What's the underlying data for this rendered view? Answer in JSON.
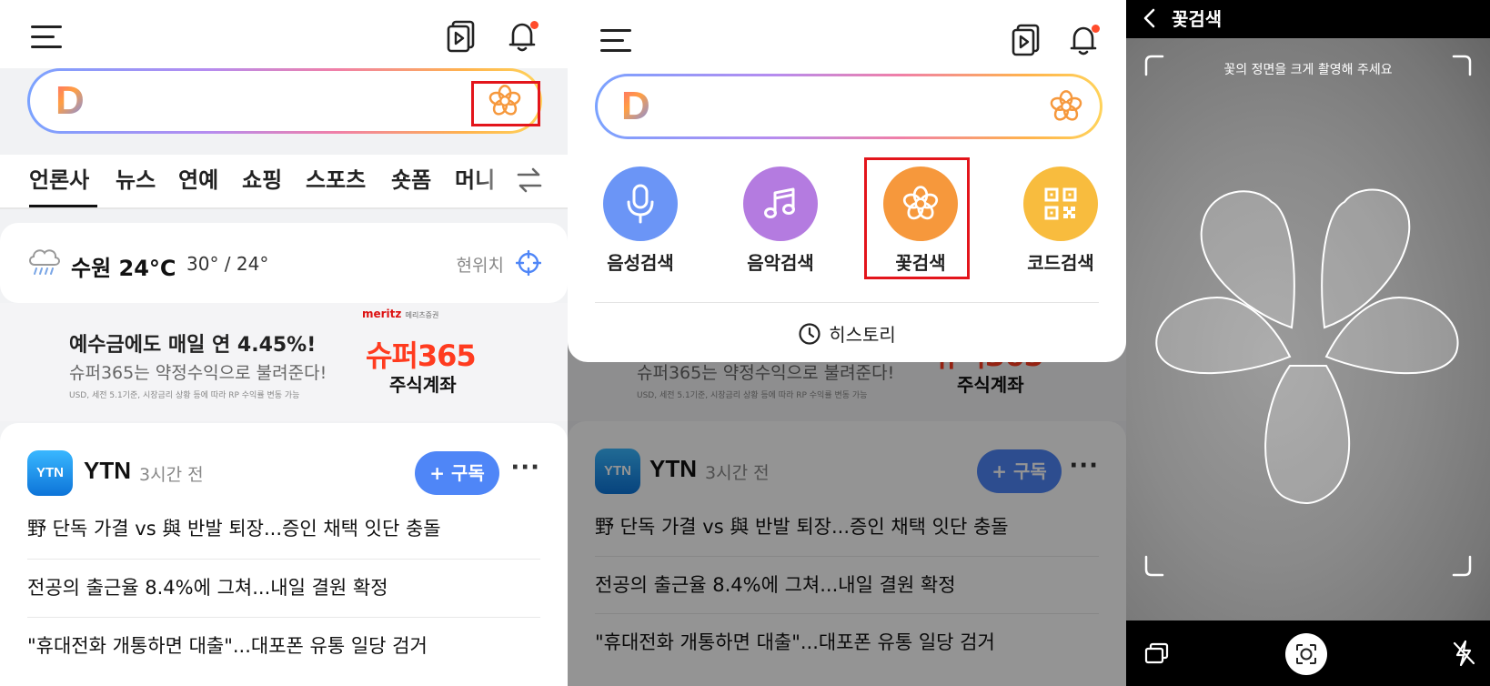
{
  "panel1": {
    "tabs": [
      "언론사",
      "뉴스",
      "연예",
      "쇼핑",
      "스포츠",
      "숏폼",
      "머니"
    ],
    "weather": {
      "city_temp": "수원 24°C",
      "range": "30° / 24°",
      "location_label": "현위치"
    },
    "ad": {
      "headline": "예수금에도 매일 연 4.45%!",
      "sub": "슈퍼365는 약정수익으로 불려준다!",
      "fine_print": "USD, 세전 5.1기준, 시장금리 상황 등에 따라 RP 수익률 변동 가능",
      "brand": "meritz",
      "brand_sub": "메리츠증권",
      "logo_line1": "슈퍼365",
      "logo_line2": "주식계좌"
    },
    "news": {
      "press_logo": "YTN",
      "press_name": "YTN",
      "time": "3시간 전",
      "subscribe_label": "+ 구독",
      "more_label": "···",
      "headlines": [
        "野 단독 가결 vs 與 반발 퇴장...증인 채택 잇단 충돌",
        "전공의 출근율 8.4%에 그쳐...내일 결원 확정",
        "\"휴대전화 개통하면 대출\"...대포폰 유통 일당 검거"
      ]
    }
  },
  "panel2": {
    "quick_search": [
      {
        "label": "음성검색",
        "icon": "microphone-icon",
        "color": "#6b95f6"
      },
      {
        "label": "음악검색",
        "icon": "music-note-icon",
        "color": "#b47be0"
      },
      {
        "label": "꽃검색",
        "icon": "flower-icon",
        "color": "#f6983c"
      },
      {
        "label": "코드검색",
        "icon": "qr-code-icon",
        "color": "#f8bc3e"
      }
    ],
    "history_label": "히스토리"
  },
  "panel3": {
    "title": "꽃검색",
    "hint": "꽃의 정면을 크게 촬영해 주세요"
  },
  "colors": {
    "highlight": "#e3151b",
    "accent_blue": "#4f86f7",
    "flower_orange": "#f6983c"
  }
}
